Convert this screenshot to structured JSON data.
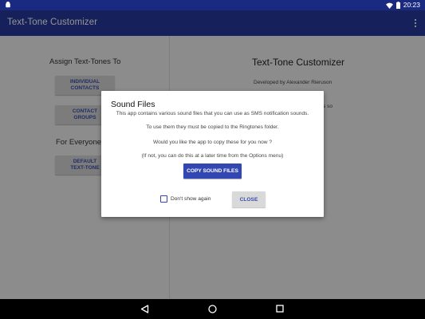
{
  "status_bar": {
    "time": "20:23",
    "icons": [
      "android-icon",
      "wifi-icon",
      "battery-icon"
    ]
  },
  "app_bar": {
    "title": "Text-Tone Customizer",
    "menu_icon": "overflow-menu-icon"
  },
  "left_pane": {
    "assign_title": "Assign Text-Tones To",
    "individual_contacts": "INDIVIDUAL\nCONTACTS",
    "contact_groups": "CONTACT\nGROUPS",
    "everyone_title": "For Everyone",
    "default_text_tone": "DEFAULT\nTEXT-TONE"
  },
  "right_pane": {
    "title": "Text-Tone Customizer",
    "developer": "Developed by Alexander Rieruson",
    "description": "wing SMS and MMS messages so\nyou look at the screen."
  },
  "dialog": {
    "title": "Sound Files",
    "line1": "This app contains various sound files that you can use as SMS notification sounds.",
    "line2": "To use them they must be copied to the Ringtones folder.",
    "line3": "Would you like the app to copy these for you now ?",
    "line4": "(If not, you can do this at a later time from the Options menu)",
    "copy_button": "COPY SOUND FILES",
    "dont_show_label": "Don't show again",
    "dont_show_checked": false,
    "close_button": "CLOSE"
  },
  "nav_bar": {
    "icons": [
      "back-icon",
      "home-icon",
      "recents-icon"
    ]
  },
  "colors": {
    "status_bar": "#1a2a80",
    "app_bar": "#26389c",
    "accent": "#3347b2"
  }
}
